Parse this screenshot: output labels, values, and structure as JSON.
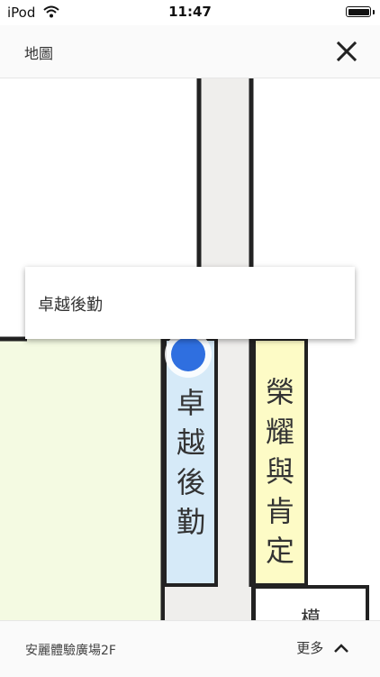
{
  "status_bar": {
    "carrier": "iPod",
    "time": "11:47"
  },
  "header": {
    "title": "地圖"
  },
  "map": {
    "popup_label": "卓越後勤",
    "rooms": [
      {
        "label": "卓越後勤",
        "color": "#d6eaf8"
      },
      {
        "label": "榮耀與肯定",
        "color": "#fdfbc6"
      },
      {
        "label": "模",
        "color": "#ffffff"
      }
    ],
    "floor_color": "#f4fae2",
    "corridor_color": "#efeeec",
    "marker_color": "#2f6fe0"
  },
  "bottom_bar": {
    "location": "安麗體驗廣場2F",
    "more_label": "更多"
  }
}
